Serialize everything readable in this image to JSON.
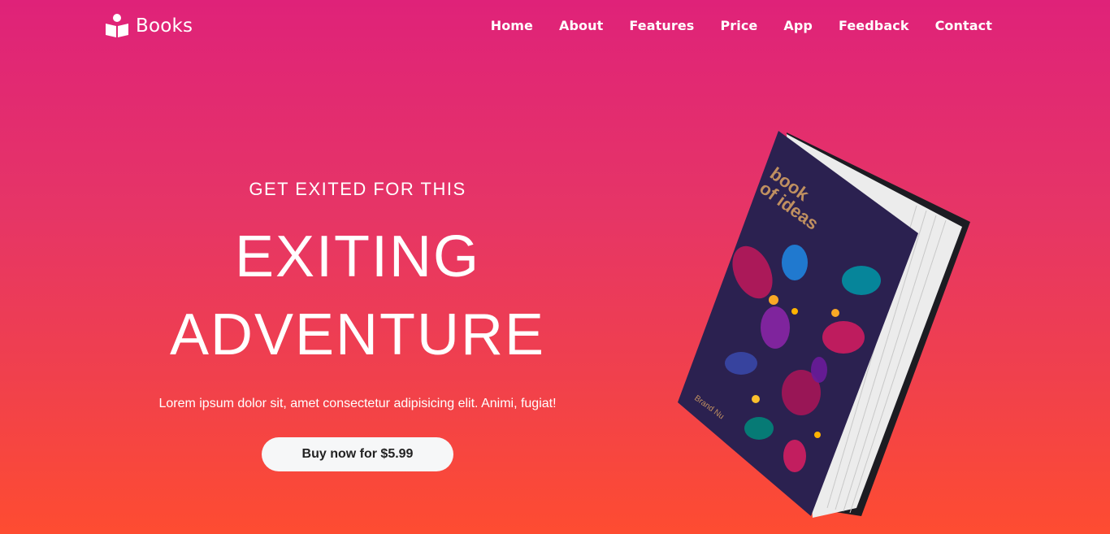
{
  "brand": {
    "name": "Books",
    "icon": "book-reader-icon"
  },
  "nav": {
    "items": [
      {
        "label": "Home"
      },
      {
        "label": "About"
      },
      {
        "label": "Features"
      },
      {
        "label": "Price"
      },
      {
        "label": "App"
      },
      {
        "label": "Feedback"
      },
      {
        "label": "Contact"
      }
    ]
  },
  "hero": {
    "kicker": "GET EXITED FOR THIS",
    "headline_line1": "EXITING",
    "headline_line2": "ADVENTURE",
    "blurb": "Lorem ipsum dolor sit, amet consectetur adipisicing elit. Animi, fugiat!",
    "cta_label": "Buy now for $5.99"
  },
  "book": {
    "title_line1": "book",
    "title_line2": "of ideas",
    "publisher": "Brand Nu"
  },
  "colors": {
    "gradient_top": "#df2279",
    "gradient_bottom": "#fe4c31",
    "book_cover": "#2b2150",
    "button_bg": "#f6f7f8"
  }
}
